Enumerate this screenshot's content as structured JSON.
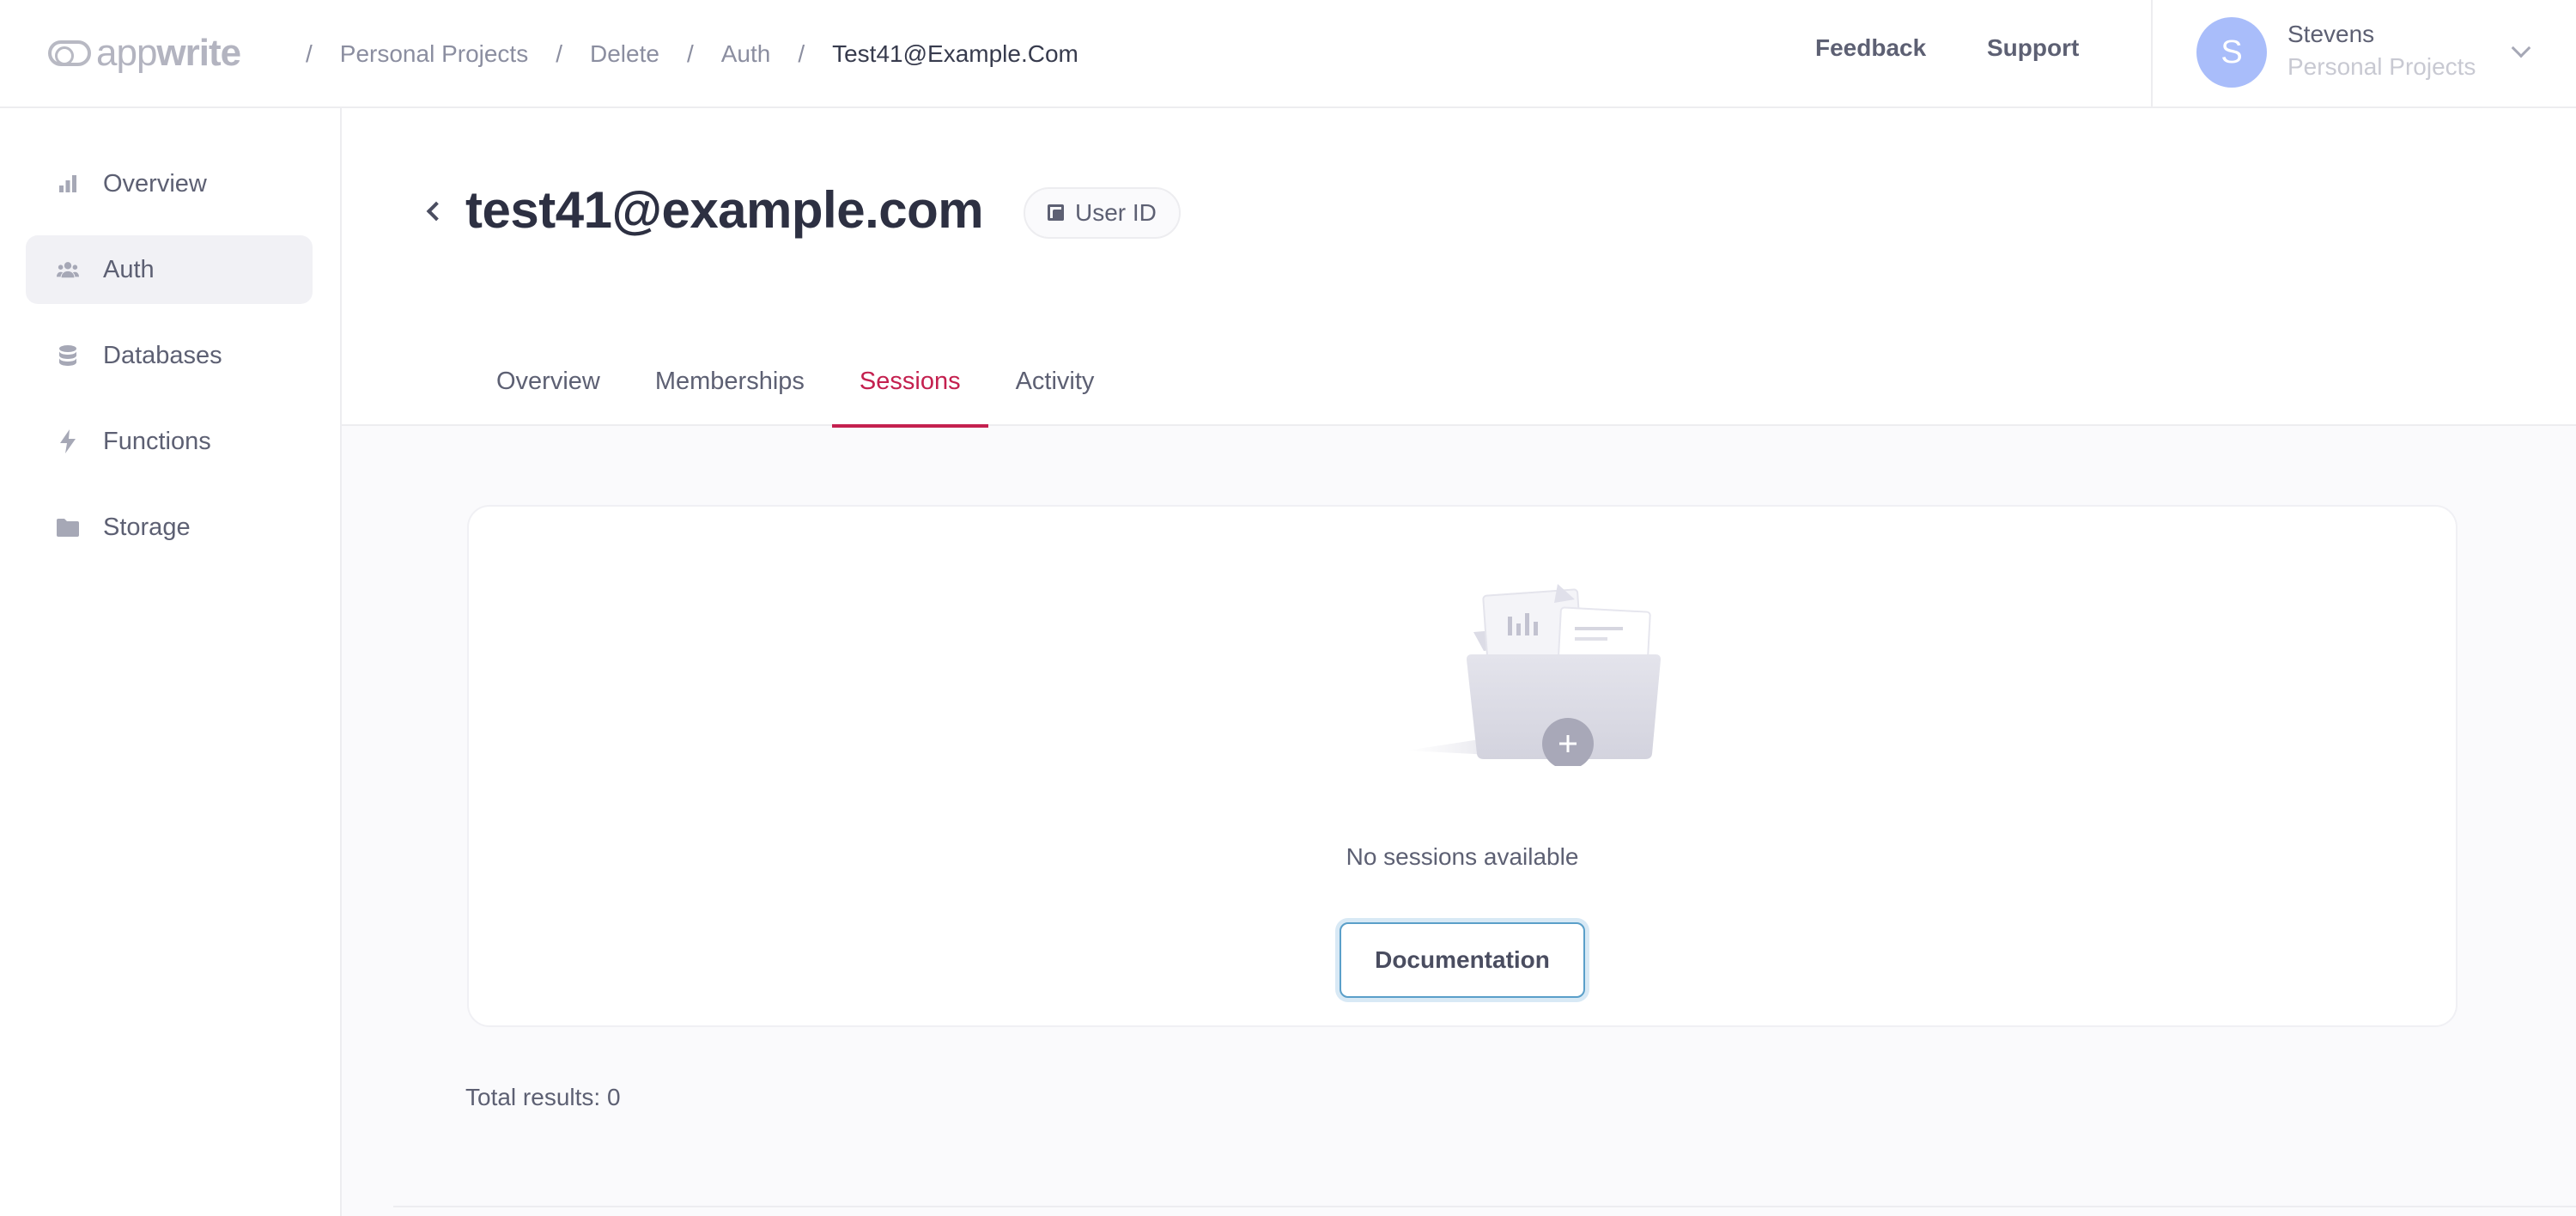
{
  "header": {
    "logo_text": "appwrite",
    "breadcrumb": [
      "Personal Projects",
      "Delete",
      "Auth",
      "Test41@Example.Com"
    ],
    "separator": "/",
    "feedback": "Feedback",
    "support": "Support",
    "user": {
      "initial": "S",
      "name": "Stevens",
      "org": "Personal Projects"
    }
  },
  "sidebar": {
    "items": [
      {
        "label": "Overview",
        "icon": "chart-bar-icon"
      },
      {
        "label": "Auth",
        "icon": "users-icon",
        "active": true
      },
      {
        "label": "Databases",
        "icon": "database-icon"
      },
      {
        "label": "Functions",
        "icon": "lightning-icon"
      },
      {
        "label": "Storage",
        "icon": "folder-icon"
      }
    ]
  },
  "main": {
    "title": "test41@example.com",
    "user_id_label": "User ID",
    "tabs": [
      {
        "label": "Overview"
      },
      {
        "label": "Memberships"
      },
      {
        "label": "Sessions",
        "active": true
      },
      {
        "label": "Activity"
      }
    ],
    "empty_text": "No sessions available",
    "doc_button": "Documentation",
    "total": "Total results: 0"
  },
  "colors": {
    "accent": "#c4204f",
    "avatar": "#a9bdfa"
  }
}
